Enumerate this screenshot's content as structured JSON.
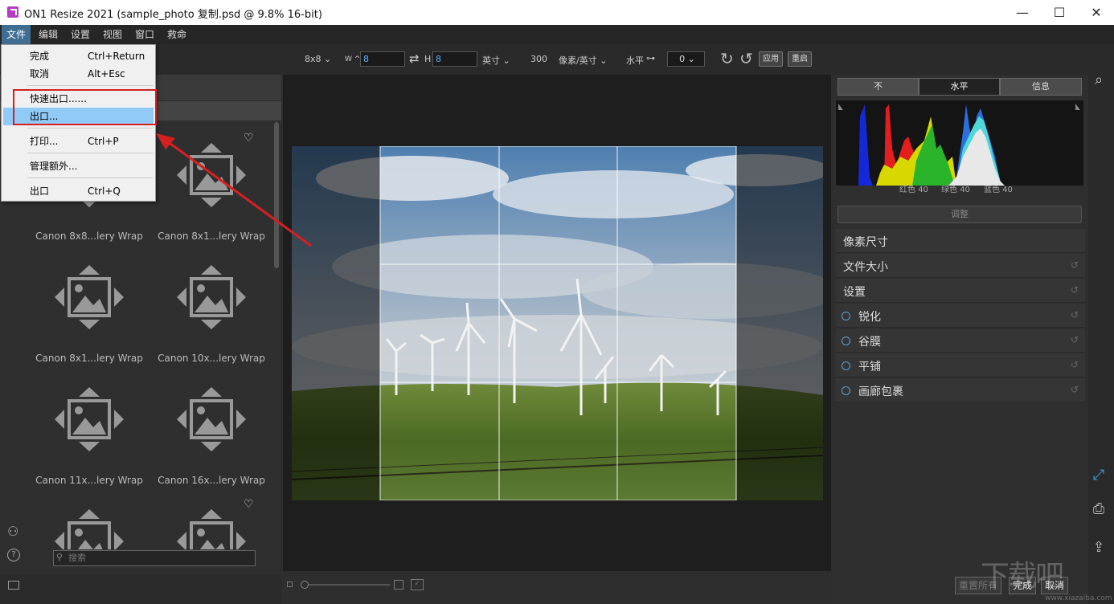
{
  "window": {
    "title": "ON1 Resize 2021 (sample_photo 复制.psd @ 9.8% 16-bit)",
    "minimize": "—",
    "maximize": "☐",
    "close": "✕"
  },
  "menubar": [
    "文件",
    "编辑",
    "设置",
    "视图",
    "窗口",
    "救命"
  ],
  "file_menu": {
    "items": [
      {
        "label": "完成",
        "shortcut": "Ctrl+Return"
      },
      {
        "label": "取消",
        "shortcut": "Alt+Esc"
      },
      {
        "label": "快速出口......",
        "shortcut": ""
      },
      {
        "label": "出口...",
        "shortcut": ""
      },
      {
        "label": "打印...",
        "shortcut": "Ctrl+P"
      },
      {
        "label": "管理额外...",
        "shortcut": ""
      },
      {
        "label": "出口",
        "shortcut": "Ctrl+Q"
      }
    ]
  },
  "toolbar": {
    "preset": "8x8",
    "width_label": "W ^",
    "width_value": "8",
    "height_label": "H",
    "height_value": "8",
    "unit": "英寸",
    "resolution": "300",
    "res_unit": "像素/英寸",
    "level_label": "水平",
    "level_value": "0",
    "apply": "应用",
    "reset": "重启"
  },
  "presets": [
    {
      "label": "Canon 8x8...lery Wrap",
      "favorite": false
    },
    {
      "label": "Canon 8x1...lery Wrap",
      "favorite": true
    },
    {
      "label": "Canon 8x1...lery Wrap",
      "favorite": false
    },
    {
      "label": "Canon 10x...lery Wrap",
      "favorite": false
    },
    {
      "label": "Canon 11x...lery Wrap",
      "favorite": false
    },
    {
      "label": "Canon 16x...lery Wrap",
      "favorite": false
    }
  ],
  "heart": "♡",
  "search_placeholder": "搜索",
  "right_panel": {
    "tabs": [
      "不",
      "水平",
      "信息"
    ],
    "active_tab": 1,
    "histogram_labels": {
      "red": "红色",
      "red_val": "40",
      "green": "绿色",
      "green_val": "40",
      "blue": "蓝色",
      "blue_val": "40"
    },
    "adjust_button": "调整",
    "sections": [
      {
        "label": "像素尺寸",
        "radio": false,
        "reset": false
      },
      {
        "label": "文件大小",
        "radio": false,
        "reset": true
      },
      {
        "label": "设置",
        "radio": false,
        "reset": true
      },
      {
        "label": "锐化",
        "radio": true,
        "reset": true
      },
      {
        "label": "谷膜",
        "radio": true,
        "reset": true
      },
      {
        "label": "平铺",
        "radio": true,
        "reset": true
      },
      {
        "label": "画廊包裹",
        "radio": true,
        "reset": true
      }
    ]
  },
  "bottom_buttons": {
    "reset_all": "重置所有",
    "done": "完成",
    "cancel": "取消"
  },
  "watermark": {
    "text": "下载吧",
    "url": "www.xiazaiba.com"
  },
  "colors": {
    "accent": "#5fb0ff",
    "highlight": "#91c9f7",
    "annotation": "#d62020",
    "menu_active": "#3f6e93"
  }
}
